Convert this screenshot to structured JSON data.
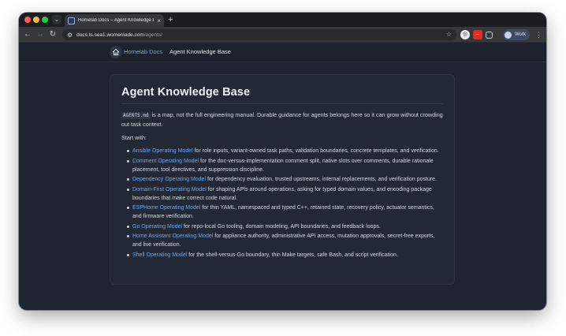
{
  "browser": {
    "tab_title": "Homelab Docs – Agent Knowledge Base",
    "new_tab": "+",
    "tab_close": "×",
    "url_host": "docs.ts.sea1.womenlade.com",
    "url_path": "/agents/",
    "profile_label": "Work",
    "icons": {
      "back": "arrow-left-icon",
      "forward": "arrow-right-icon",
      "reload": "reload-icon",
      "star": "star-icon",
      "menu": "kebab-menu-icon"
    }
  },
  "site": {
    "brand": "Homelab Docs",
    "breadcrumb": "Agent Knowledge Base"
  },
  "page": {
    "title": "Agent Knowledge Base",
    "intro_code": "AGENTS.md",
    "intro_text": " is a map, not the full engineering manual. Durable guidance for agents belongs here so it can grow without crowding out task context.",
    "start_with": "Start with:",
    "items": [
      {
        "link": "Ansible Operating Model",
        "text": " for role inputs, variant-owned task paths, validation boundaries, concrete templates, and verification."
      },
      {
        "link": "Comment Operating Model",
        "text": " for the doc-versus-implementation comment split, native slots over comments, durable rationale placement, tool directives, and suppression discipline."
      },
      {
        "link": "Dependency Operating Model",
        "text": " for dependency evaluation, trusted upstreams, internal replacements, and verification posture."
      },
      {
        "link": "Domain-First Operating Model",
        "text": " for shaping APIs around operations, asking for typed domain values, and encoding package boundaries that make correct code natural."
      },
      {
        "link": "ESPHome Operating Model",
        "text": " for thin YAML, namespaced and typed C++, retained state, recovery policy, actuator semantics, and firmware verification."
      },
      {
        "link": "Go Operating Model",
        "text": " for repo-local Go tooling, domain modeling, API boundaries, and feedback loops."
      },
      {
        "link": "Home Assistant Operating Model",
        "text": " for appliance authority, administrative API access, mutation approvals, secret-free exports, and live verification."
      },
      {
        "link": "Shell Operating Model",
        "text": " for the shell-versus-Go boundary, thin Make targets, safe Bash, and script verification."
      }
    ]
  }
}
